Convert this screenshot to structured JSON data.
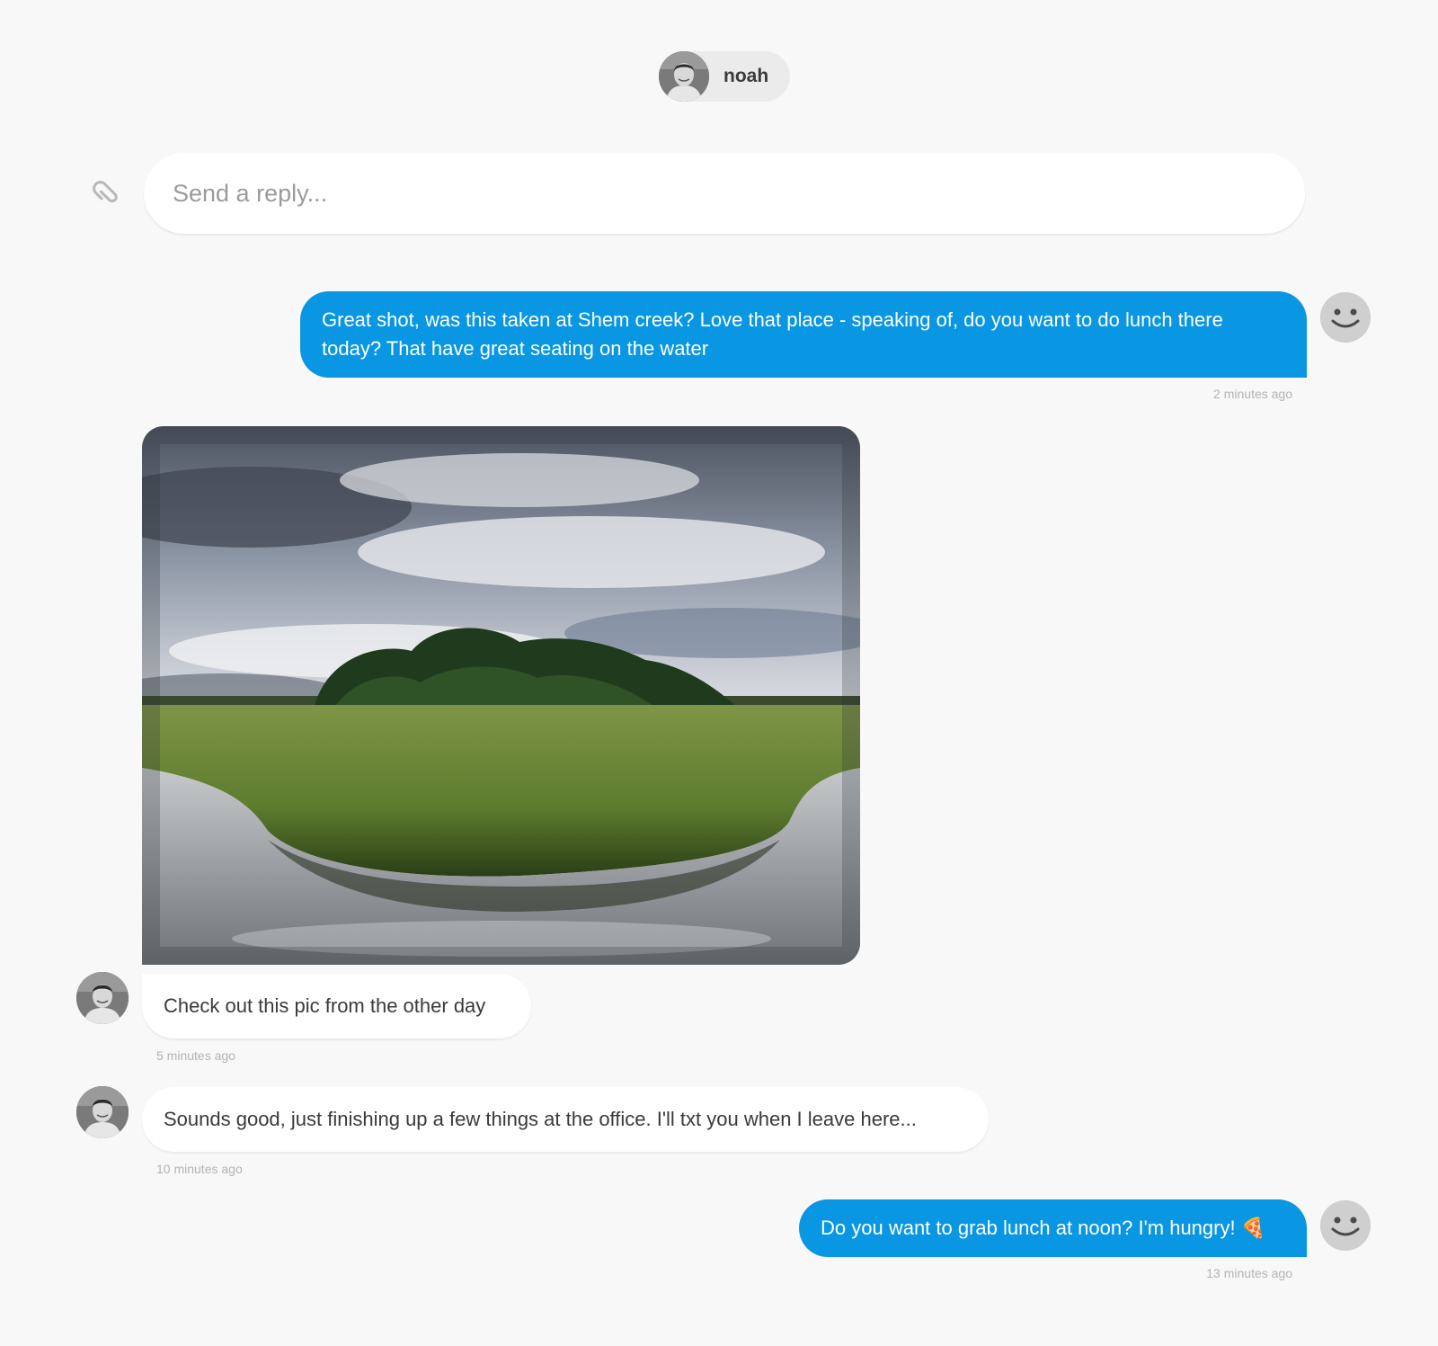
{
  "header": {
    "contact_name": "noah"
  },
  "composer": {
    "placeholder": "Send a reply...",
    "attach_icon": "paperclip-icon"
  },
  "messages": [
    {
      "direction": "outgoing",
      "text": "Great shot, was this taken at Shem creek? Love that place - speaking of, do you want to do lunch there today? That have great seating on the water",
      "time": "2 minutes ago"
    },
    {
      "direction": "incoming",
      "attachment": "photo-marsh-landscape",
      "text": "Check out this pic from the other day",
      "time": "5 minutes ago"
    },
    {
      "direction": "incoming",
      "text": "Sounds good, just finishing up a few things at the office. I'll txt you when I leave here...",
      "time": "10 minutes ago"
    },
    {
      "direction": "outgoing",
      "text": "Do you want to grab lunch at noon? I'm hungry! 🍕",
      "time": "13 minutes ago"
    }
  ],
  "colors": {
    "background": "#f8f8f8",
    "outgoing_bubble": "#0996e2",
    "incoming_bubble": "#ffffff",
    "timestamp": "#b3b3b3"
  }
}
